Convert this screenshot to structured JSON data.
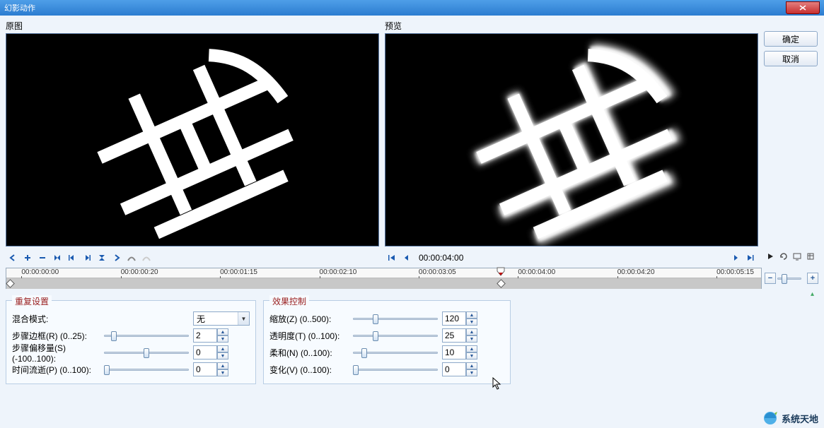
{
  "window": {
    "title": "幻影动作"
  },
  "panels": {
    "original": "原图",
    "preview": "预览"
  },
  "buttons": {
    "ok": "确定",
    "cancel": "取消"
  },
  "playback": {
    "time": "00:00:04:00"
  },
  "timeline": {
    "ticks": [
      "00:00:00:00",
      "00:00:00:20",
      "00:00:01:15",
      "00:00:02:10",
      "00:00:03:05",
      "00:00:04:00",
      "00:00:04:20",
      "00:00:05:15"
    ],
    "marker_pos_pct": 65.5,
    "key_start_pct": 0.5,
    "key_end_pct": 65.5,
    "minus": "−",
    "plus": "+"
  },
  "groups": {
    "repeat": {
      "title": "重复设置",
      "blend_label": "混合模式:",
      "blend_value": "无",
      "step_border_label": "步骤边框(R) (0..25):",
      "step_border_value": "2",
      "step_offset_label": "步骤偏移量(S) (-100..100):",
      "step_offset_value": "0",
      "time_fade_label": "时间流逝(P) (0..100):",
      "time_fade_value": "0"
    },
    "effect": {
      "title": "效果控制",
      "zoom_label": "缩放(Z) (0..500):",
      "zoom_value": "120",
      "opacity_label": "透明度(T) (0..100):",
      "opacity_value": "25",
      "soft_label": "柔和(N) (0..100):",
      "soft_value": "10",
      "change_label": "变化(V) (0..100):",
      "change_value": "0"
    }
  },
  "footer": {
    "brand": "系统天地"
  }
}
